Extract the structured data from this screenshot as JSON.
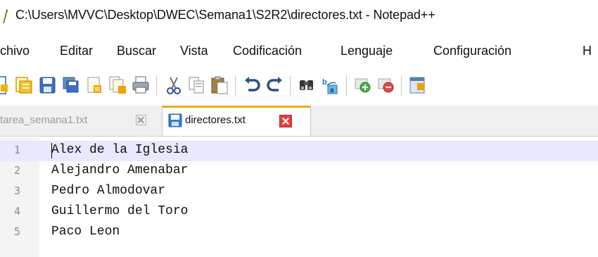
{
  "window": {
    "title": "C:\\Users\\MVVC\\Desktop\\DWEC\\Semana1\\S2R2\\directores.txt - Notepad++"
  },
  "menu": {
    "items": [
      "chivo",
      "Editar",
      "Buscar",
      "Vista",
      "Codificación",
      "Lenguaje",
      "Configuración",
      "H"
    ]
  },
  "toolbar": {
    "icons": [
      "new-file-icon",
      "open-file-icon",
      "save-icon",
      "save-all-icon",
      "close-icon",
      "close-all-icon",
      "print-icon",
      "cut-icon",
      "copy-icon",
      "paste-icon",
      "undo-icon",
      "redo-icon",
      "find-icon",
      "replace-icon",
      "zoom-in-icon",
      "zoom-out-icon",
      "sync-scroll-icon"
    ]
  },
  "tabs": [
    {
      "label": "tarea_semana1.txt",
      "active": false
    },
    {
      "label": "directores.txt",
      "active": true
    }
  ],
  "editor": {
    "lines": [
      {
        "num": "1",
        "text": "Alex de la Iglesia"
      },
      {
        "num": "2",
        "text": "Alejandro Amenabar"
      },
      {
        "num": "3",
        "text": "Pedro Almodovar"
      },
      {
        "num": "4",
        "text": "Guillermo del Toro"
      },
      {
        "num": "5",
        "text": "Paco Leon"
      }
    ],
    "current_line": 1
  },
  "colors": {
    "active_tab_accent": "#f5a623",
    "current_line_bg": "#e8e8ff",
    "tab_close_red": "#e04040"
  }
}
